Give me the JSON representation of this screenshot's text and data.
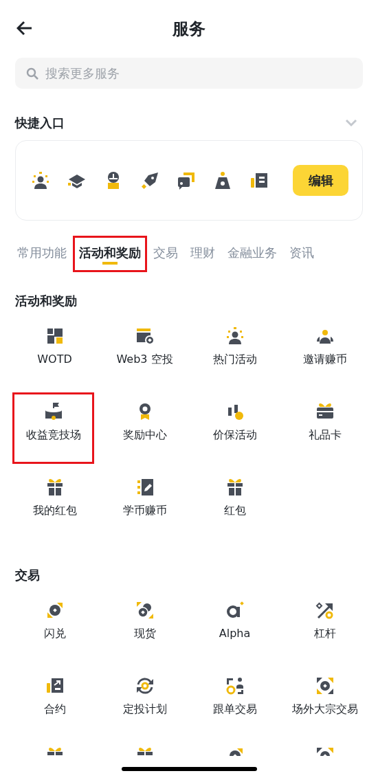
{
  "header": {
    "title": "服务"
  },
  "search": {
    "placeholder": "搜索更多服务"
  },
  "shortcuts": {
    "title": "快捷入口",
    "expanded": false,
    "edit_button": "编辑"
  },
  "tabs": [
    {
      "label": "常用功能",
      "selected": false,
      "highlighted": false
    },
    {
      "label": "活动和奖励",
      "selected": true,
      "highlighted": true
    },
    {
      "label": "交易",
      "selected": false,
      "highlighted": false
    },
    {
      "label": "理财",
      "selected": false,
      "highlighted": false
    },
    {
      "label": "金融业务",
      "selected": false,
      "highlighted": false
    },
    {
      "label": "资讯",
      "selected": false,
      "highlighted": false
    }
  ],
  "sections": [
    {
      "title": "活动和奖励",
      "items": [
        {
          "label": "WOTD",
          "highlighted": false
        },
        {
          "label": "Web3 空投",
          "highlighted": false
        },
        {
          "label": "热门活动",
          "highlighted": false
        },
        {
          "label": "邀请赚币",
          "highlighted": false
        },
        {
          "label": "收益竞技场",
          "highlighted": true
        },
        {
          "label": "奖励中心",
          "highlighted": false
        },
        {
          "label": "价保活动",
          "highlighted": false
        },
        {
          "label": "礼品卡",
          "highlighted": false
        },
        {
          "label": "我的红包",
          "highlighted": false
        },
        {
          "label": "学币赚币",
          "highlighted": false
        },
        {
          "label": "红包",
          "highlighted": false
        }
      ]
    },
    {
      "title": "交易",
      "items": [
        {
          "label": "闪兑",
          "highlighted": false
        },
        {
          "label": "现货",
          "highlighted": false
        },
        {
          "label": "Alpha",
          "highlighted": false
        },
        {
          "label": "杠杆",
          "highlighted": false
        },
        {
          "label": "合约",
          "highlighted": false
        },
        {
          "label": "定投计划",
          "highlighted": false
        },
        {
          "label": "跟单交易",
          "highlighted": false
        },
        {
          "label": "场外大宗交易",
          "highlighted": false
        }
      ]
    }
  ]
}
